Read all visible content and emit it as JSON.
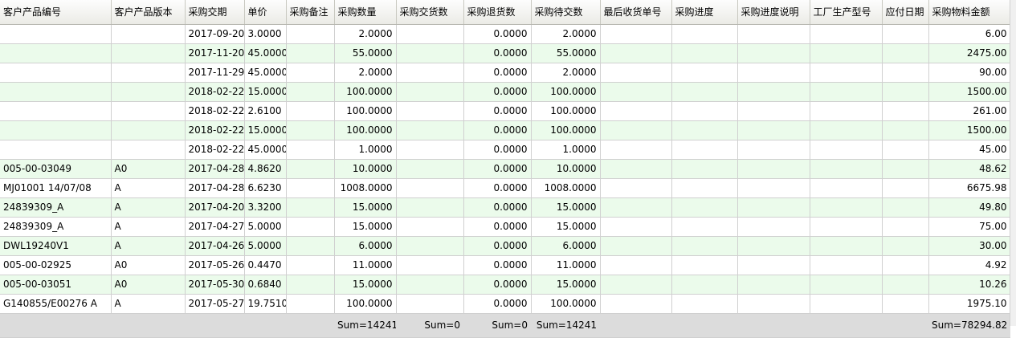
{
  "columns": [
    "客户产品编号",
    "客户产品版本",
    "采购交期",
    "单价",
    "采购备注",
    "采购数量",
    "采购交货数",
    "采购退货数",
    "采购待交数",
    "最后收货单号",
    "采购进度",
    "采购进度说明",
    "工厂生产型号",
    "应付日期",
    "采购物料金额"
  ],
  "rows": [
    [
      "",
      "",
      "2017-09-20",
      "3.0000",
      "",
      "2.0000",
      "",
      "0.0000",
      "2.0000",
      "",
      "",
      "",
      "",
      "",
      "6.00"
    ],
    [
      "",
      "",
      "2017-11-20",
      "45.0000",
      "",
      "55.0000",
      "",
      "0.0000",
      "55.0000",
      "",
      "",
      "",
      "",
      "",
      "2475.00"
    ],
    [
      "",
      "",
      "2017-11-29",
      "45.0000",
      "",
      "2.0000",
      "",
      "0.0000",
      "2.0000",
      "",
      "",
      "",
      "",
      "",
      "90.00"
    ],
    [
      "",
      "",
      "2018-02-22",
      "15.0000",
      "",
      "100.0000",
      "",
      "0.0000",
      "100.0000",
      "",
      "",
      "",
      "",
      "",
      "1500.00"
    ],
    [
      "",
      "",
      "2018-02-22",
      "2.6100",
      "",
      "100.0000",
      "",
      "0.0000",
      "100.0000",
      "",
      "",
      "",
      "",
      "",
      "261.00"
    ],
    [
      "",
      "",
      "2018-02-22",
      "15.0000",
      "",
      "100.0000",
      "",
      "0.0000",
      "100.0000",
      "",
      "",
      "",
      "",
      "",
      "1500.00"
    ],
    [
      "",
      "",
      "2018-02-22",
      "45.0000",
      "",
      "1.0000",
      "",
      "0.0000",
      "1.0000",
      "",
      "",
      "",
      "",
      "",
      "45.00"
    ],
    [
      "005-00-03049",
      "A0",
      "2017-04-28",
      "4.8620",
      "",
      "10.0000",
      "",
      "0.0000",
      "10.0000",
      "",
      "",
      "",
      "",
      "",
      "48.62"
    ],
    [
      "MJ01001 14/07/08",
      "A",
      "2017-04-28",
      "6.6230",
      "",
      "1008.0000",
      "",
      "0.0000",
      "1008.0000",
      "",
      "",
      "",
      "",
      "",
      "6675.98"
    ],
    [
      "24839309_A",
      "A",
      "2017-04-20",
      "3.3200",
      "",
      "15.0000",
      "",
      "0.0000",
      "15.0000",
      "",
      "",
      "",
      "",
      "",
      "49.80"
    ],
    [
      "24839309_A",
      "A",
      "2017-04-27",
      "5.0000",
      "",
      "15.0000",
      "",
      "0.0000",
      "15.0000",
      "",
      "",
      "",
      "",
      "",
      "75.00"
    ],
    [
      "DWL19240V1",
      "A",
      "2017-04-26",
      "5.0000",
      "",
      "6.0000",
      "",
      "0.0000",
      "6.0000",
      "",
      "",
      "",
      "",
      "",
      "30.00"
    ],
    [
      "005-00-02925",
      "A0",
      "2017-05-26",
      "0.4470",
      "",
      "11.0000",
      "",
      "0.0000",
      "11.0000",
      "",
      "",
      "",
      "",
      "",
      "4.92"
    ],
    [
      "005-00-03051",
      "A0",
      "2017-05-30",
      "0.6840",
      "",
      "15.0000",
      "",
      "0.0000",
      "15.0000",
      "",
      "",
      "",
      "",
      "",
      "10.26"
    ],
    [
      "G140855/E00276 A",
      "A",
      "2017-05-27",
      "19.7510",
      "",
      "100.0000",
      "",
      "0.0000",
      "100.0000",
      "",
      "",
      "",
      "",
      "",
      "1975.10"
    ]
  ],
  "footer": [
    "",
    "",
    "",
    "",
    "",
    "Sum=14241",
    "Sum=0",
    "Sum=0",
    "Sum=14241",
    "",
    "",
    "",
    "",
    "",
    "Sum=78294.82"
  ]
}
